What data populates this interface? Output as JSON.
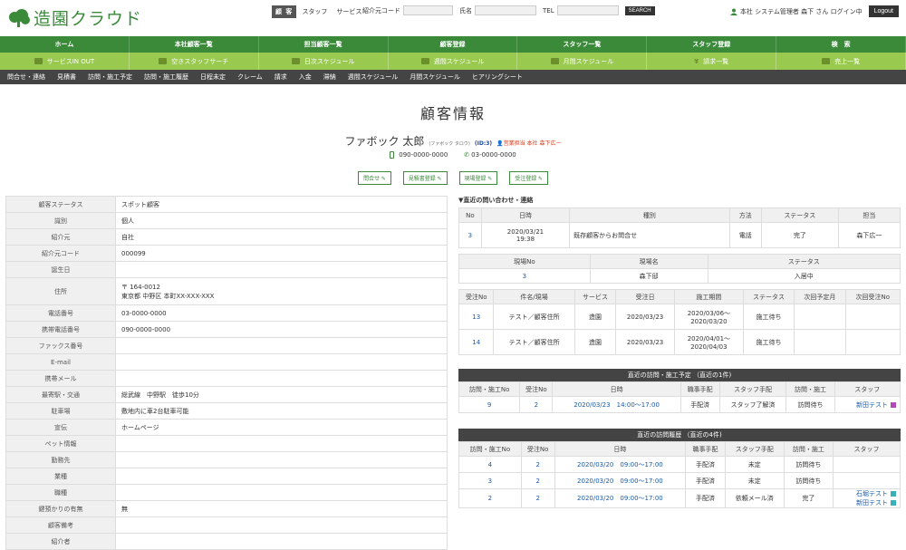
{
  "header": {
    "logo": "造園クラウド",
    "tabs": [
      "顧 客",
      "スタッフ",
      "サービス"
    ],
    "fields": [
      "紹介元コード",
      "氏名",
      "TEL"
    ],
    "search": "SEARCH",
    "user": "本社  システム管理者  森下 さん ログイン中",
    "logout": "Logout"
  },
  "nav1": [
    "ホーム",
    "本社顧客一覧",
    "担当顧客一覧",
    "顧客登録",
    "スタッフ一覧",
    "スタッフ登録",
    "検　索"
  ],
  "nav2": [
    "サービスIN OUT",
    "空きスタッフサーチ",
    "日次スケジュール",
    "週間スケジュール",
    "月間スケジュール",
    "請求一覧",
    "売上一覧"
  ],
  "nav3": [
    "問合せ・連絡",
    "見積書",
    "訪問・施工予定",
    "訪問・施工履歴",
    "日程未定",
    "クレーム",
    "請求",
    "入金",
    "滞納",
    "週間スケジュール",
    "月間スケジュール",
    "ヒアリングシート"
  ],
  "page_title": "顧客情報",
  "customer": {
    "name": "ファボック 太郎",
    "kana": "(ファボック タロウ)",
    "id": "(ID:3)",
    "staff": "営業担当 本社  森下広一",
    "mobile": "090-0000-0000",
    "tel": "03-0000-0000"
  },
  "actions": [
    "問合せ",
    "見積書登録",
    "現場登録",
    "受注登録"
  ],
  "info": [
    [
      "顧客ステータス",
      "スポット顧客"
    ],
    [
      "識別",
      "個人"
    ],
    [
      "紹介元",
      "自社"
    ],
    [
      "紹介元コード",
      "000099"
    ],
    [
      "誕生日",
      ""
    ],
    [
      "住所",
      "〒 164-0012\n東京都 中野区 本町XX-XXX-XXX"
    ],
    [
      "電話番号",
      "03-0000-0000"
    ],
    [
      "携帯電話番号",
      "090-0000-0000"
    ],
    [
      "ファックス番号",
      ""
    ],
    [
      "E-mail",
      ""
    ],
    [
      "携帯メール",
      ""
    ],
    [
      "最寄駅・交通",
      "総武線　中野駅　徒歩10分"
    ],
    [
      "駐車場",
      "敷地内に車2台駐車可能"
    ],
    [
      "宣伝",
      "ホームページ"
    ],
    [
      "ペット情報",
      ""
    ],
    [
      "勤務先",
      ""
    ],
    [
      "業種",
      ""
    ],
    [
      "職種",
      ""
    ],
    [
      "鍵預かりの有無",
      "無"
    ],
    [
      "顧客備考",
      ""
    ],
    [
      "紹介者",
      ""
    ]
  ],
  "inq": {
    "title": "▼直近の問い合わせ・連絡",
    "cols": [
      "No",
      "日時",
      "種別",
      "方法",
      "ステータス",
      "担当"
    ],
    "rows": [
      [
        "3",
        "2020/03/21\n19:38",
        "既存顧客からお問合せ",
        "電話",
        "完了",
        "森下広一"
      ]
    ]
  },
  "site": {
    "cols": [
      "現場No",
      "現場名",
      "ステータス"
    ],
    "rows": [
      [
        "3",
        "森下邸",
        "入居中"
      ]
    ]
  },
  "orders": {
    "cols": [
      "受注No",
      "件名/現場",
      "サービス",
      "受注日",
      "施工期間",
      "ステータス",
      "次回予定月",
      "次回受注No"
    ],
    "rows": [
      [
        "13",
        "テスト／顧客住所",
        "造園",
        "2020/03/23",
        "2020/03/06～\n2020/03/20",
        "施工待ち",
        "",
        ""
      ],
      [
        "14",
        "テスト／顧客住所",
        "造園",
        "2020/03/23",
        "2020/04/01～\n2020/04/03",
        "施工待ち",
        "",
        ""
      ]
    ]
  },
  "plan": {
    "title": "直近の訪問・施工予定 （直近の1件)",
    "cols": [
      "訪問・施工No",
      "受注No",
      "日時",
      "職事手配",
      "スタッフ手配",
      "訪問・施工",
      "スタッフ"
    ],
    "rows": [
      [
        "9",
        "2",
        "2020/03/23　14:00～17:00",
        "手配済",
        "スタッフ了解済",
        "訪問待ち",
        "新田テスト"
      ]
    ]
  },
  "hist": {
    "title": "直近の訪問履歴 （直近の4件)",
    "cols": [
      "訪問・施工No",
      "受注No",
      "日時",
      "職事手配",
      "スタッフ手配",
      "訪問・施工",
      "スタッフ"
    ],
    "rows": [
      [
        "4",
        "2",
        "2020/03/20　09:00～17:00",
        "手配済",
        "未定",
        "訪問待ち",
        ""
      ],
      [
        "3",
        "2",
        "2020/03/20　09:00～17:00",
        "手配済",
        "未定",
        "訪問待ち",
        ""
      ],
      [
        "2",
        "2",
        "2020/03/20　09:00～17:00",
        "手配済",
        "依頼メール済",
        "完了",
        "石堀テスト\n新田テスト"
      ]
    ]
  },
  "colors": {
    "green": "#3a8a3a",
    "lightgreen": "#99c94f",
    "dark": "#444444",
    "purple": "#b04ab8",
    "teal": "#3ab0b8"
  }
}
